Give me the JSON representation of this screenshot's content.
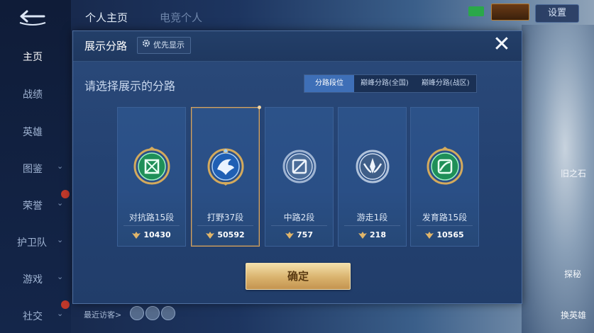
{
  "background": {
    "top_tabs": [
      "个人主页",
      "电竞个人"
    ],
    "settings_label": "设置",
    "sidebar_items": [
      {
        "label": "主页",
        "active": true,
        "chevron": false
      },
      {
        "label": "战绩",
        "active": false,
        "chevron": false
      },
      {
        "label": "英雄",
        "active": false,
        "chevron": false
      },
      {
        "label": "图鉴",
        "active": false,
        "chevron": true
      },
      {
        "label": "荣誉",
        "active": false,
        "chevron": true
      },
      {
        "label": "护卫队",
        "active": false,
        "chevron": true
      },
      {
        "label": "游戏",
        "active": false,
        "chevron": true
      },
      {
        "label": "社交",
        "active": false,
        "chevron": true
      }
    ],
    "right_labels": [
      "旧之石",
      "探秘",
      "换英雄"
    ],
    "recent_visitors_label": "最近访客>"
  },
  "modal": {
    "title": "展示分路",
    "priority_label": "优先显示",
    "close_symbol": "✕",
    "subtitle": "请选择展示的分路",
    "filter_tabs": [
      {
        "label": "分路段位",
        "active": true
      },
      {
        "label": "巅峰分路(全国)",
        "active": false
      },
      {
        "label": "巅峰分路(战区)",
        "active": false
      }
    ],
    "lanes": [
      {
        "name": "对抗路15段",
        "score": "10430",
        "icon": "clash-lane-emblem-icon",
        "color": "#2fb36b",
        "selected": false
      },
      {
        "name": "打野37段",
        "score": "50592",
        "icon": "jungle-emblem-icon",
        "color": "#3a7fd6",
        "selected": true
      },
      {
        "name": "中路2段",
        "score": "757",
        "icon": "mid-lane-emblem-icon",
        "color": "#6f8fb8",
        "selected": false
      },
      {
        "name": "游走1段",
        "score": "218",
        "icon": "roam-emblem-icon",
        "color": "#7d93b3",
        "selected": false
      },
      {
        "name": "发育路15段",
        "score": "10565",
        "icon": "farm-lane-emblem-icon",
        "color": "#2fb36b",
        "selected": false
      }
    ],
    "confirm_label": "确定"
  },
  "colors": {
    "accent_gold": "#d9b26d",
    "modal_bg": "#244272",
    "active_tab": "#3e6fb7"
  }
}
